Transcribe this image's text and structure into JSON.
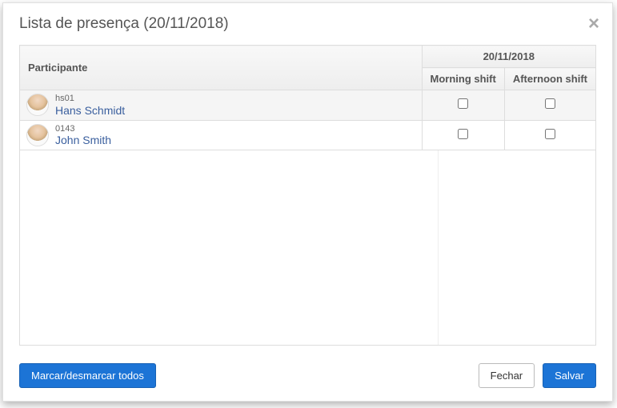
{
  "header": {
    "title": "Lista de presença (20/11/2018)"
  },
  "table": {
    "participant_header": "Participante",
    "date_header": "20/11/2018",
    "shifts": [
      "Morning shift",
      "Afternoon shift"
    ],
    "rows": [
      {
        "id": "hs01",
        "name": "Hans Schmidt",
        "checks": [
          false,
          false
        ]
      },
      {
        "id": "0143",
        "name": "John Smith",
        "checks": [
          false,
          false
        ]
      }
    ]
  },
  "footer": {
    "toggle_all": "Marcar/desmarcar todos",
    "close": "Fechar",
    "save": "Salvar"
  }
}
